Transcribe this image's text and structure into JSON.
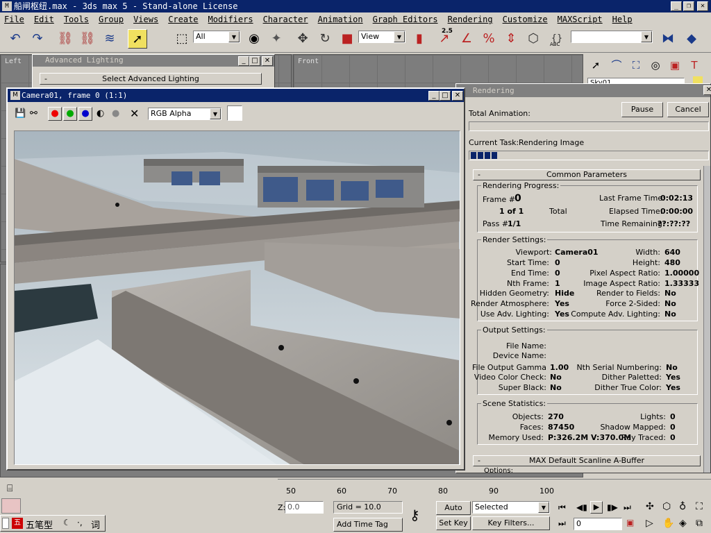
{
  "app": {
    "title": "船闸枢纽.max - 3ds max 5 - Stand-alone License",
    "icon": "max-app-icon"
  },
  "menu": [
    "File",
    "Edit",
    "Tools",
    "Group",
    "Views",
    "Create",
    "Modifiers",
    "Character",
    "Animation",
    "Graph Editors",
    "Rendering",
    "Customize",
    "MAXScript",
    "Help"
  ],
  "toolbar": {
    "selection_filter": "All",
    "ref_coord": "View",
    "spinner_snap": "2.5",
    "percent_snap": "%",
    "abc_label": "ABC"
  },
  "viewports": {
    "left": "Left",
    "front": "Front"
  },
  "advanced_lighting": {
    "title": "Advanced Lighting",
    "rollout": "Select Advanced Lighting",
    "collapse": "-"
  },
  "frame_window": {
    "title": "Camera01, frame 0 (1:1)",
    "channel": "RGB Alpha"
  },
  "command_panel": {
    "object_name": "Sky01"
  },
  "rendering": {
    "title": "Rendering",
    "total_animation": "Total Animation:",
    "pause": "Pause",
    "cancel": "Cancel",
    "current_task_label": "Current Task:",
    "current_task": "Rendering Image",
    "progress_blocks": 4,
    "common_parameters": "Common Parameters",
    "collapse": "-",
    "progress": {
      "title": "Rendering Progress:",
      "frame_label": "Frame #",
      "frame": "0",
      "of_count": "1 of 1",
      "total": "Total",
      "pass_label": "Pass #",
      "pass": "1/1",
      "last_frame_time_label": "Last Frame Time:",
      "last_frame_time": "0:02:13",
      "elapsed_label": "Elapsed Time:",
      "elapsed": "0:00:00",
      "remaining_label": "Time Remaining:",
      "remaining": "??:??:??"
    },
    "settings": {
      "title": "Render Settings:",
      "viewport_label": "Viewport:",
      "viewport": "Camera01",
      "start_label": "Start Time:",
      "start": "0",
      "end_label": "End Time:",
      "end": "0",
      "nth_label": "Nth Frame:",
      "nth": "1",
      "hidden_label": "Hidden Geometry:",
      "hidden": "Hide",
      "atmos_label": "Render Atmosphere:",
      "atmos": "Yes",
      "adv_label": "Use Adv. Lighting:",
      "adv": "Yes",
      "width_label": "Width:",
      "width": "640",
      "height_label": "Height:",
      "height": "480",
      "pixel_label": "Pixel Aspect Ratio:",
      "pixel": "1.00000",
      "image_label": "Image Aspect Ratio:",
      "image": "1.33333",
      "fields_label": "Render to Fields:",
      "fields": "No",
      "force_label": "Force 2-Sided:",
      "force": "No",
      "compute_label": "Compute Adv. Lighting:",
      "compute": "No"
    },
    "output": {
      "title": "Output Settings:",
      "file_label": "File Name:",
      "device_label": "Device Name:",
      "gamma_label": "File Output Gamma",
      "gamma": "1.00",
      "vcc_label": "Video Color Check:",
      "vcc": "No",
      "super_label": "Super Black:",
      "super": "No",
      "serial_label": "Nth Serial Numbering:",
      "serial": "No",
      "dpal_label": "Dither Paletted:",
      "dpal": "Yes",
      "dtrue_label": "Dither True Color:",
      "dtrue": "Yes"
    },
    "scene": {
      "title": "Scene Statistics:",
      "objects_label": "Objects:",
      "objects": "270",
      "faces_label": "Faces:",
      "faces": "87450",
      "memory_label": "Memory Used:",
      "memory": "P:326.2M V:370.0M",
      "lights_label": "Lights:",
      "lights": "0",
      "shadow_label": "Shadow Mapped:",
      "shadow": "0",
      "ray_label": "Ray Traced:",
      "ray": "0"
    },
    "scanline": "MAX Default Scanline A-Buffer",
    "options": "Options:"
  },
  "timeline": {
    "ticks": [
      "50",
      "60",
      "70",
      "80",
      "90",
      "100"
    ]
  },
  "status": {
    "grid": "Grid = 10.0",
    "add_time_tag": "Add Time Tag",
    "auto_key": "Auto Key",
    "set_key": "Set Key",
    "selected": "Selected",
    "key_filters": "Key Filters...",
    "frame": "0",
    "coord_label": "Z:",
    "coord": "0.0"
  },
  "ime": {
    "mode": "五笔型",
    "punct": "·,",
    "word": "词"
  }
}
